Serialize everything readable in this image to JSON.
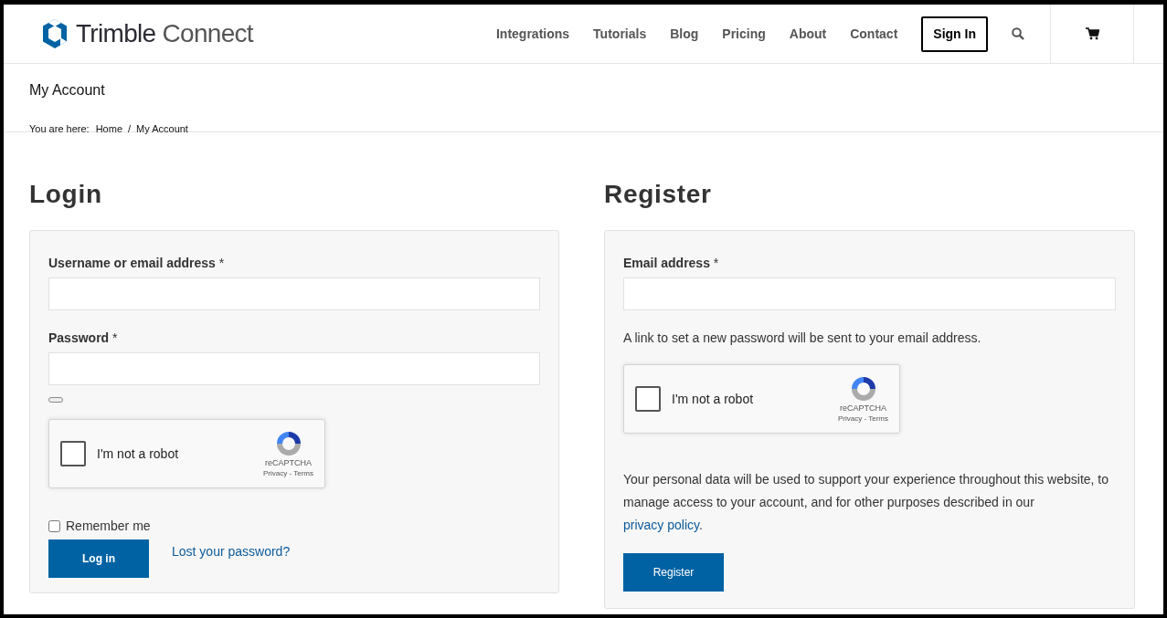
{
  "header": {
    "logo": {
      "brand": "Trimble",
      "product": "Connect"
    },
    "nav": [
      {
        "label": "Integrations",
        "kind": "link"
      },
      {
        "label": "Tutorials",
        "kind": "link"
      },
      {
        "label": "Blog",
        "kind": "link"
      },
      {
        "label": "Pricing",
        "kind": "link"
      },
      {
        "label": "About",
        "kind": "link"
      },
      {
        "label": "Contact",
        "kind": "link"
      },
      {
        "label": "Sign In",
        "kind": "outlined"
      }
    ]
  },
  "page_title": "My Account",
  "breadcrumb": {
    "prefix": "You are here:",
    "items": [
      "Home",
      "My Account"
    ],
    "separator": "/"
  },
  "login": {
    "heading": "Login",
    "fields": [
      {
        "label": "Username or email address",
        "required_mark": "*"
      },
      {
        "label": "Password",
        "required_mark": "*"
      }
    ],
    "captcha": {
      "label": "I'm not a robot",
      "brand": "reCAPTCHA",
      "links": "Privacy - Terms",
      "checked": false
    },
    "remember": {
      "label": "Remember me",
      "checked": false
    },
    "submit": "Log in",
    "lost_password": "Lost your password?"
  },
  "register": {
    "heading": "Register",
    "fields": [
      {
        "label": "Email address",
        "required_mark": "*"
      }
    ],
    "note": "A link to set a new password will be sent to your email address.",
    "captcha": {
      "label": "I'm not a robot",
      "brand": "reCAPTCHA",
      "links": "Privacy - Terms",
      "checked": false
    },
    "privacy": {
      "before": "Your personal data will be used to support your experience throughout this website, to manage access to your account, and for other purposes described in our ",
      "link": "privacy policy",
      "after": "."
    },
    "submit": "Register"
  }
}
